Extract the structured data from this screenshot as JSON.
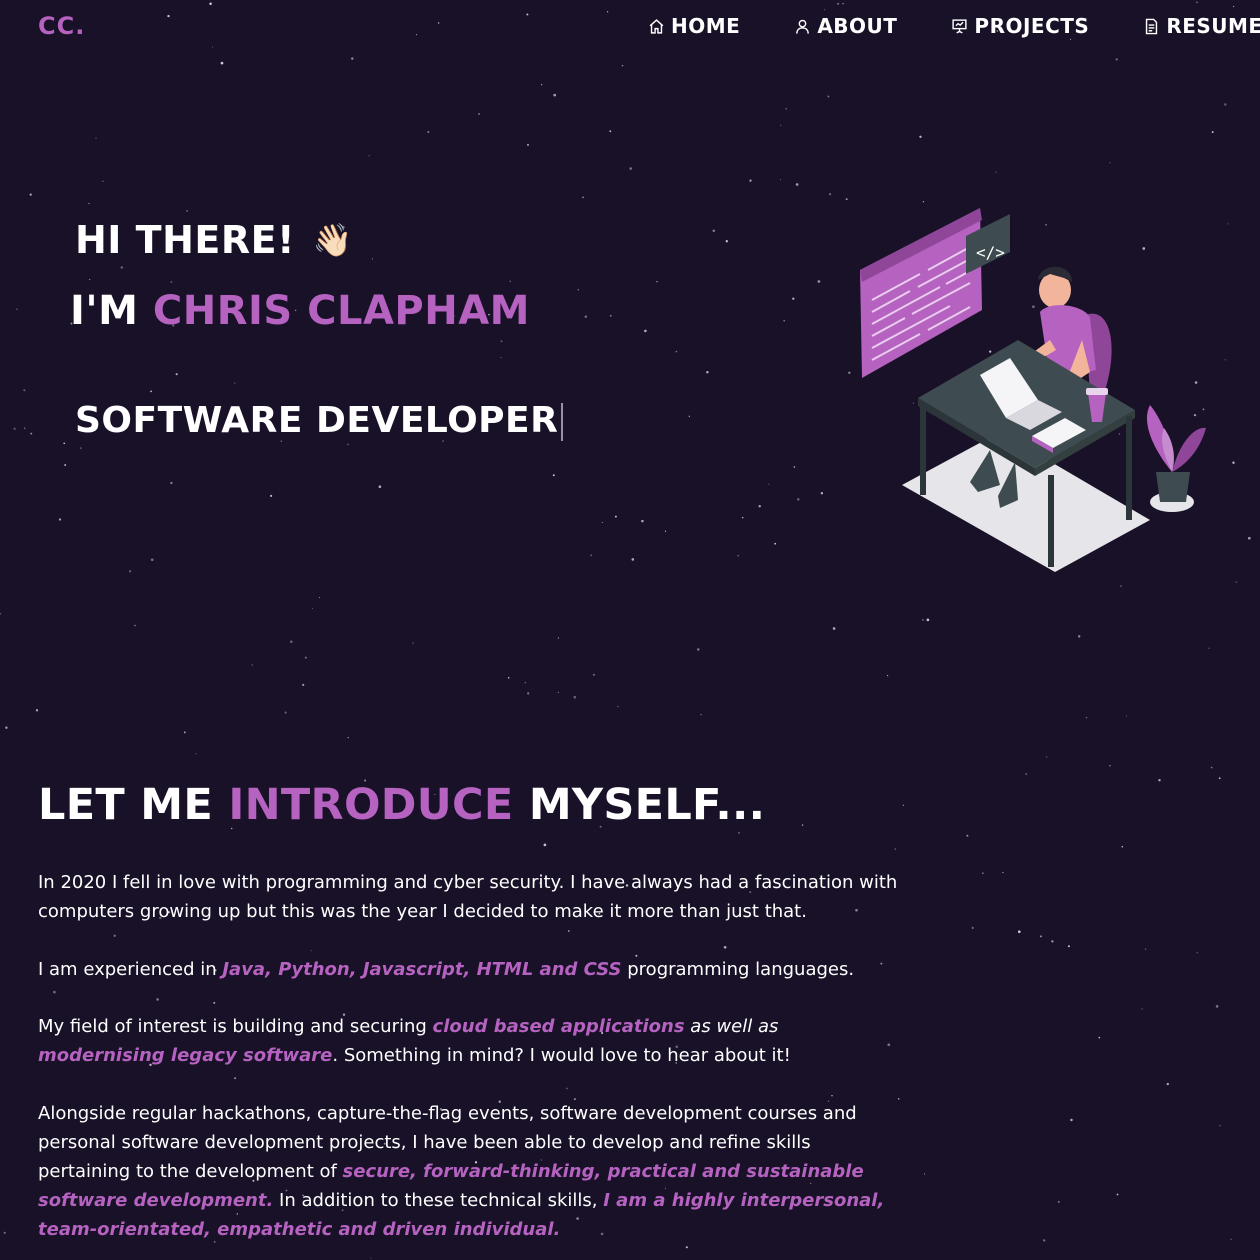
{
  "nav": {
    "logo": "CC.",
    "items": [
      {
        "label": "HOME",
        "icon": "home-icon"
      },
      {
        "label": "ABOUT",
        "icon": "user-icon"
      },
      {
        "label": "PROJECTS",
        "icon": "presentation-icon"
      },
      {
        "label": "RESUME",
        "icon": "document-icon"
      }
    ]
  },
  "hero": {
    "greeting": "HI THERE!",
    "wave_emoji": "👋🏻",
    "name_prefix": "I'M",
    "name": "CHRIS CLAPHAM",
    "role": "SOFTWARE DEVELOPER"
  },
  "intro": {
    "heading_start": "LET ME",
    "heading_accent": "INTRODUCE",
    "heading_end": "MYSELF...",
    "p1": "In 2020 I fell in love with programming and cyber security. I have always had a fascination with computers growing up but this was the year I decided to make it more than just that.",
    "p2_a": "I am experienced in ",
    "p2_hl": "Java, Python, Javascript, HTML and CSS",
    "p2_b": " programming languages.",
    "p3_a": "My field of interest is building and securing ",
    "p3_hl1": "cloud based applications",
    "p3_mid": " as well as ",
    "p3_hl2": "modernising legacy software",
    "p3_b": ". Something in mind? I would love to hear about it!",
    "p4_a": "Alongside regular hackathons, capture-the-flag events, software development courses and personal software development projects, I have been able to develop and refine skills pertaining to the development of ",
    "p4_hl1": "secure, forward-thinking, practical and sustainable software development.",
    "p4_b": " In addition to these technical skills, ",
    "p4_hl2": "I am a highly interpersonal, team-orientated, empathetic and driven individual."
  },
  "colors": {
    "background": "#181127",
    "accent": "#b562c0",
    "text": "#ffffff"
  }
}
